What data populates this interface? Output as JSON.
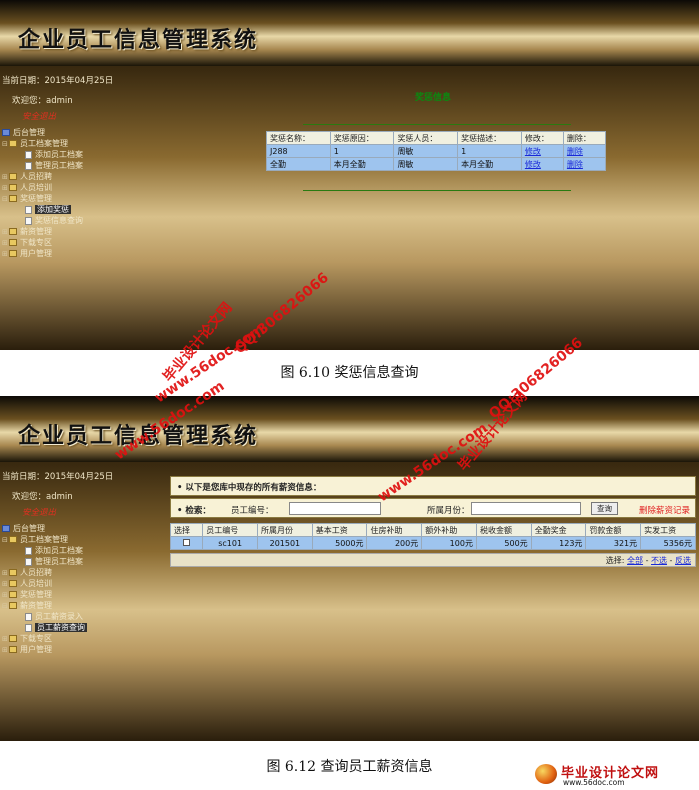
{
  "screenshot1": {
    "title": "企业员工信息管理系统",
    "date": "当前日期：2015年04月25日",
    "welcome": "欢迎您：admin",
    "logout": "安全退出",
    "tree": [
      {
        "label": "后台管理",
        "level": 0,
        "icon": "root-icon"
      },
      {
        "label": "员工档案管理",
        "level": 1,
        "icon": "folder-icon",
        "toggle": "-"
      },
      {
        "label": "添加员工档案",
        "level": 2,
        "icon": "page-icon"
      },
      {
        "label": "管理员工档案",
        "level": 2,
        "icon": "page-icon"
      },
      {
        "label": "人员招聘",
        "level": 1,
        "icon": "folder-icon",
        "toggle": "+"
      },
      {
        "label": "人员培训",
        "level": 1,
        "icon": "folder-icon",
        "toggle": "+"
      },
      {
        "label": "奖惩管理",
        "level": 1,
        "icon": "folder-icon",
        "toggle": "-"
      },
      {
        "label": "添加奖惩",
        "level": 2,
        "icon": "page-icon",
        "selected": true
      },
      {
        "label": "奖惩信息查询",
        "level": 2,
        "icon": "page-icon"
      },
      {
        "label": "薪资管理",
        "level": 1,
        "icon": "folder-icon",
        "toggle": "+"
      },
      {
        "label": "下载专区",
        "level": 1,
        "icon": "folder-icon",
        "toggle": "+"
      },
      {
        "label": "用户管理",
        "level": 1,
        "icon": "folder-icon",
        "toggle": "+"
      }
    ],
    "panel_title": "奖惩信息",
    "table": {
      "headers": [
        "奖惩名称：",
        "奖惩原因：",
        "奖惩人员：",
        "奖惩描述：",
        "修改：",
        "删除："
      ],
      "rows": [
        [
          "J288",
          "1",
          "周敏",
          "1",
          "修改",
          "删除"
        ],
        [
          "全勤",
          "本月全勤",
          "周敏",
          "本月全勤",
          "修改",
          "删除"
        ]
      ]
    },
    "caption": "图 6.10  奖惩信息查询"
  },
  "screenshot2": {
    "title": "企业员工信息管理系统",
    "date": "当前日期：2015年04月25日",
    "welcome": "欢迎您：admin",
    "logout": "安全退出",
    "tree": [
      {
        "label": "后台管理",
        "level": 0,
        "icon": "root-icon"
      },
      {
        "label": "员工档案管理",
        "level": 1,
        "icon": "folder-icon",
        "toggle": "-"
      },
      {
        "label": "添加员工档案",
        "level": 2,
        "icon": "page-icon"
      },
      {
        "label": "管理员工档案",
        "level": 2,
        "icon": "page-icon"
      },
      {
        "label": "人员招聘",
        "level": 1,
        "icon": "folder-icon",
        "toggle": "+"
      },
      {
        "label": "人员培训",
        "level": 1,
        "icon": "folder-icon",
        "toggle": "+"
      },
      {
        "label": "奖惩管理",
        "level": 1,
        "icon": "folder-icon",
        "toggle": "+"
      },
      {
        "label": "薪资管理",
        "level": 1,
        "icon": "folder-icon",
        "toggle": "-"
      },
      {
        "label": "员工薪资录入",
        "level": 2,
        "icon": "page-icon"
      },
      {
        "label": "员工薪资查询",
        "level": 2,
        "icon": "page-icon",
        "selected": true
      },
      {
        "label": "下载专区",
        "level": 1,
        "icon": "folder-icon",
        "toggle": "+"
      },
      {
        "label": "用户管理",
        "level": 1,
        "icon": "folder-icon",
        "toggle": "+"
      }
    ],
    "list_header": "• 以下是您库中现存的所有薪资信息：",
    "search": {
      "label": "• 检索：",
      "field1_label": "员工编号：",
      "field1_value": "",
      "field2_label": "所属月份：",
      "field2_value": "",
      "button": "查询",
      "delete_link": "删除薪资记录"
    },
    "table": {
      "headers": [
        "选择",
        "员工编号",
        "所属月份",
        "基本工资",
        "住房补助",
        "额外补助",
        "税收金额",
        "全勤奖金",
        "罚款金额",
        "实发工资"
      ],
      "rows": [
        [
          "",
          "sc101",
          "201501",
          "5000元",
          "200元",
          "100元",
          "500元",
          "123元",
          "321元",
          "5356元"
        ]
      ]
    },
    "footer": {
      "prefix": "选择:",
      "all": "全部",
      "none": "不选",
      "invert": "反选"
    },
    "caption": "图 6.12  查询员工薪资信息"
  },
  "watermarks": {
    "site": "www.56doc.com",
    "brand": "毕业设计论文网",
    "qq": "QQ:306826066"
  },
  "logo": {
    "text": "毕业设计论文网",
    "url": "www.56doc.com"
  }
}
